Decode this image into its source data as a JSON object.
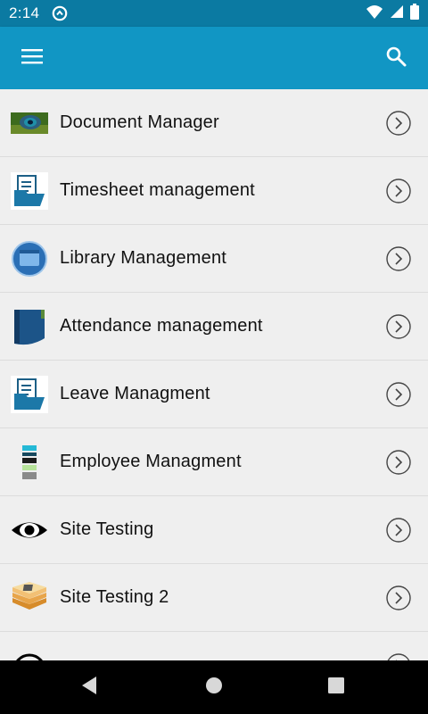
{
  "status_bar": {
    "time": "2:14",
    "left_icon": "sync-icon",
    "right_icons": [
      "wifi-icon",
      "cellular-signal-icon",
      "battery-icon"
    ]
  },
  "app_bar": {
    "menu_icon": "hamburger-menu-icon",
    "search_icon": "search-icon",
    "color": "#1196c4"
  },
  "list": {
    "items": [
      {
        "label": "Document Manager",
        "icon": "peacock-feather-image-icon"
      },
      {
        "label": "Timesheet management",
        "icon": "document-folder-icon"
      },
      {
        "label": "Library Management",
        "icon": "window-app-icon"
      },
      {
        "label": "Attendance management",
        "icon": "blue-book-icon"
      },
      {
        "label": "Leave Managment",
        "icon": "document-folder-icon"
      },
      {
        "label": "Employee Managment",
        "icon": "color-stripes-icon"
      },
      {
        "label": "Site Testing",
        "icon": "eye-icon"
      },
      {
        "label": "Site Testing 2",
        "icon": "stacked-layers-icon"
      },
      {
        "label": "",
        "icon": "partial-circle-icon"
      }
    ]
  },
  "nav_bar": {
    "buttons": [
      "back-triangle-icon",
      "home-circle-icon",
      "recents-square-icon"
    ]
  }
}
